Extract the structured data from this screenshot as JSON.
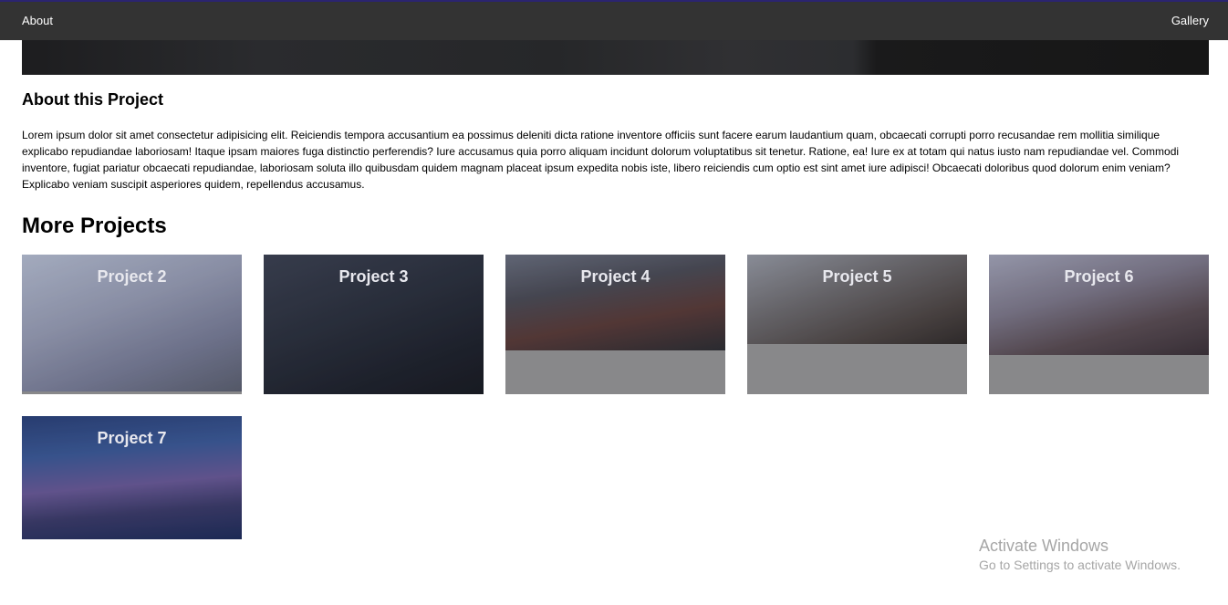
{
  "nav": {
    "about_label": "About",
    "gallery_label": "Gallery"
  },
  "about": {
    "title": "About this Project",
    "text": "Lorem ipsum dolor sit amet consectetur adipisicing elit. Reiciendis tempora accusantium ea possimus deleniti dicta ratione inventore officiis sunt facere earum laudantium quam, obcaecati corrupti porro recusandae rem mollitia similique explicabo repudiandae laboriosam! Itaque ipsam maiores fuga distinctio perferendis? Iure accusamus quia porro aliquam incidunt dolorum voluptatibus sit tenetur. Ratione, ea! Iure ex at totam qui natus iusto nam repudiandae vel. Commodi inventore, fugiat pariatur obcaecati repudiandae, laboriosam soluta illo quibusdam quidem magnam placeat ipsum expedita nobis iste, libero reiciendis cum optio est sint amet iure adipisci! Obcaecati doloribus quod dolorum enim veniam? Explicabo veniam suscipit asperiores quidem, repellendus accusamus."
  },
  "more": {
    "title": "More Projects",
    "projects": [
      {
        "label": "Project 2"
      },
      {
        "label": "Project 3"
      },
      {
        "label": "Project 4"
      },
      {
        "label": "Project 5"
      },
      {
        "label": "Project 6"
      },
      {
        "label": "Project 7"
      }
    ]
  },
  "watermark": {
    "title": "Activate Windows",
    "subtitle": "Go to Settings to activate Windows."
  }
}
